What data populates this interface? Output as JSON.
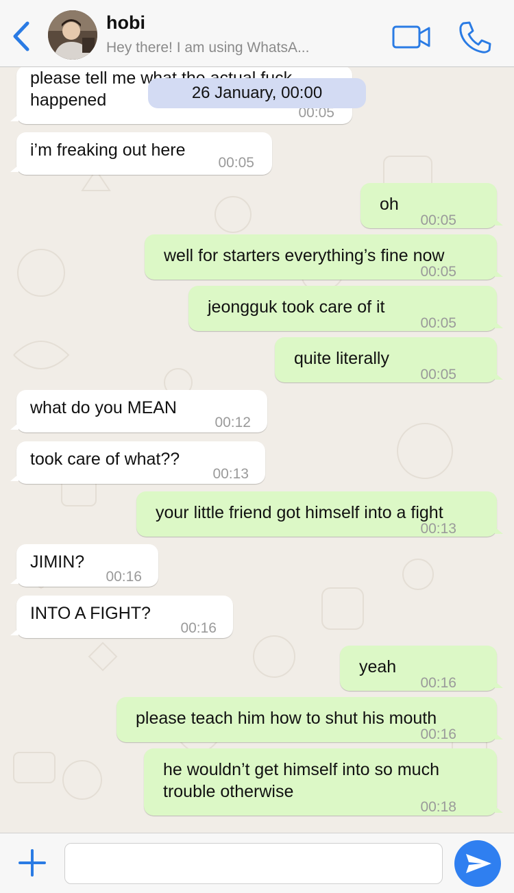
{
  "header": {
    "contact_name": "hobi",
    "contact_status": "Hey there! I am using WhatsA...",
    "accent": "#2a7be4"
  },
  "chat": {
    "date_separator": "26 January, 00:00",
    "messages": [
      {
        "dir": "in",
        "text": "please tell me what the actual fuck\nhappened",
        "time": "00:05"
      },
      {
        "dir": "in",
        "text": "i’m freaking out here",
        "time": "00:05"
      },
      {
        "dir": "out",
        "text": "oh",
        "time": "00:05"
      },
      {
        "dir": "out",
        "text": "well for starters everything’s fine now",
        "time": "00:05"
      },
      {
        "dir": "out",
        "text": "jeongguk took care of it",
        "time": "00:05"
      },
      {
        "dir": "out",
        "text": "quite literally",
        "time": "00:05"
      },
      {
        "dir": "in",
        "text": "what do you MEAN",
        "time": "00:12"
      },
      {
        "dir": "in",
        "text": "took care of what??",
        "time": "00:13"
      },
      {
        "dir": "out",
        "text": "your little friend got himself into a fight",
        "time": "00:13"
      },
      {
        "dir": "in",
        "text": "JIMIN?",
        "time": "00:16"
      },
      {
        "dir": "in",
        "text": "INTO A FIGHT?",
        "time": "00:16"
      },
      {
        "dir": "out",
        "text": "yeah",
        "time": "00:16"
      },
      {
        "dir": "out",
        "text": "please teach him how to shut his mouth",
        "time": "00:16"
      },
      {
        "dir": "out",
        "text": "he wouldn’t get himself into so much\ntrouble otherwise",
        "time": "00:18"
      }
    ]
  },
  "input": {
    "value": "",
    "placeholder": ""
  },
  "colors": {
    "incoming_bubble": "#ffffff",
    "outgoing_bubble": "#dcf8c6",
    "date_pill": "#d3dbf3",
    "send_button": "#2f7ff0"
  }
}
